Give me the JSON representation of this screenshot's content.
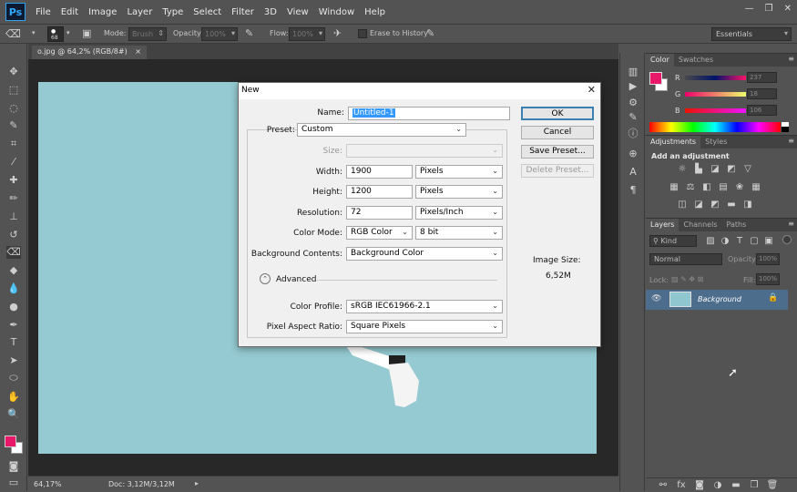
{
  "app": {
    "logo": "Ps"
  },
  "menu": [
    "File",
    "Edit",
    "Image",
    "Layer",
    "Type",
    "Select",
    "Filter",
    "3D",
    "View",
    "Window",
    "Help"
  ],
  "window_controls": {
    "minimize": "—",
    "restore": "❐",
    "close": "✕"
  },
  "options_bar": {
    "brush_size": "68",
    "mode_label": "Mode:",
    "mode_value": "Brush",
    "opacity_label": "Opacity:",
    "opacity_value": "100%",
    "flow_label": "Flow:",
    "flow_value": "100%",
    "erase_history_label": "Erase to History",
    "workspace": "Essentials"
  },
  "document": {
    "tab_label": "o.jpg @ 64,2% (RGB/8#)",
    "tab_close": "×",
    "zoom": "64,17%",
    "doc_info": "Doc: 3,12M/3,12M"
  },
  "colors": {
    "foreground": "#e8176a",
    "background": "#ffffff",
    "canvas_bg": "#8fc6cf",
    "selection": "#3399ff"
  },
  "color_panel": {
    "tabs": [
      "Color",
      "Swatches"
    ],
    "channels": [
      {
        "label": "R",
        "value": "237"
      },
      {
        "label": "G",
        "value": "18"
      },
      {
        "label": "B",
        "value": "106"
      }
    ]
  },
  "adjustments_panel": {
    "tabs": [
      "Adjustments",
      "Styles"
    ],
    "title": "Add an adjustment"
  },
  "layers_panel": {
    "tabs": [
      "Layers",
      "Channels",
      "Paths"
    ],
    "filter_kind": "Kind",
    "blend_mode": "Normal",
    "opacity_label": "Opacity:",
    "opacity_value": "100%",
    "lock_label": "Lock:",
    "fill_label": "Fill:",
    "fill_value": "100%",
    "layers": [
      {
        "name": "Background"
      }
    ]
  },
  "dialog": {
    "title": "New",
    "name_label": "Name:",
    "name_value": "Untitled-1",
    "preset_label": "Preset:",
    "preset_value": "Custom",
    "size_label": "Size:",
    "width_label": "Width:",
    "width_value": "1900",
    "width_unit": "Pixels",
    "height_label": "Height:",
    "height_value": "1200",
    "height_unit": "Pixels",
    "resolution_label": "Resolution:",
    "resolution_value": "72",
    "resolution_unit": "Pixels/Inch",
    "color_mode_label": "Color Mode:",
    "color_mode_value": "RGB Color",
    "bit_depth": "8 bit",
    "bg_contents_label": "Background Contents:",
    "bg_contents_value": "Background Color",
    "advanced_label": "Advanced",
    "color_profile_label": "Color Profile:",
    "color_profile_value": "sRGB IEC61966-2.1",
    "pixel_aspect_label": "Pixel Aspect Ratio:",
    "pixel_aspect_value": "Square Pixels",
    "ok_label": "OK",
    "cancel_label": "Cancel",
    "save_preset_label": "Save Preset...",
    "delete_preset_label": "Delete Preset...",
    "image_size_label": "Image Size:",
    "image_size_value": "6,52M"
  }
}
